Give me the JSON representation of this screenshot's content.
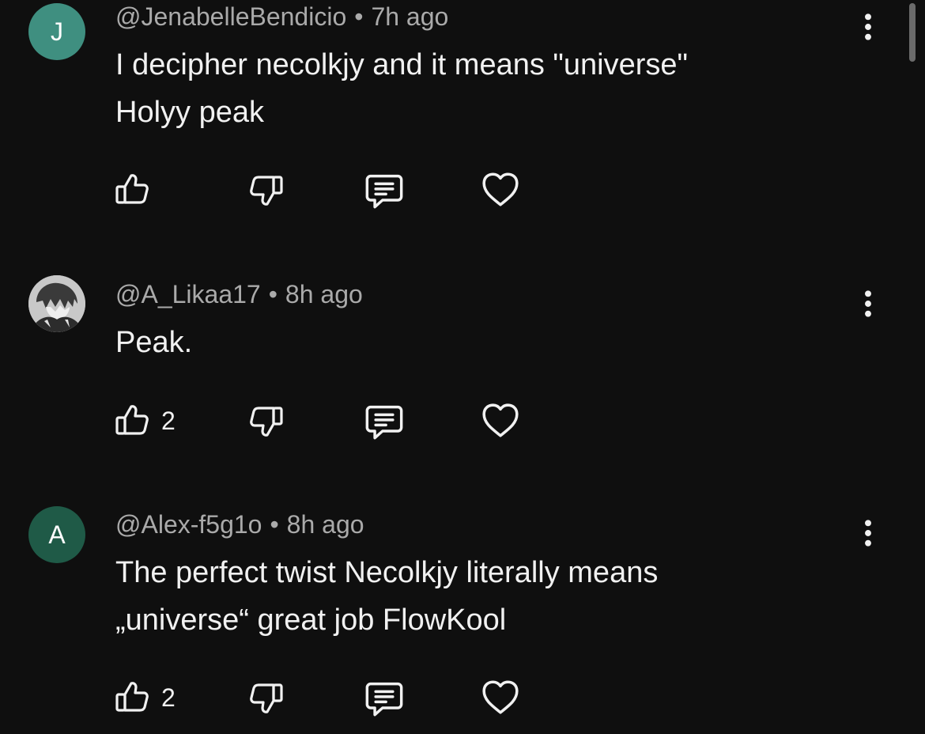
{
  "colors": {
    "background": "#0f0f0f",
    "text_primary": "#f1f1f1",
    "text_secondary": "#aaaaaa",
    "avatar_j": "#3f8f80",
    "avatar_a": "#1f5a47"
  },
  "comments": [
    {
      "avatar_letter": "J",
      "author": "@JenabelleBendicio",
      "separator": "•",
      "time": "7h ago",
      "text": "I decipher necolkjy and it means \"universe\"\nHolyy peak",
      "like_count": "",
      "icons": [
        "thumbs-up-icon",
        "thumbs-down-icon",
        "reply-icon",
        "heart-icon",
        "more-vertical-icon"
      ]
    },
    {
      "avatar_letter": "",
      "author": "@A_Likaa17",
      "separator": "•",
      "time": "8h ago",
      "text": "Peak.",
      "like_count": "2",
      "icons": [
        "thumbs-up-icon",
        "thumbs-down-icon",
        "reply-icon",
        "heart-icon",
        "more-vertical-icon"
      ]
    },
    {
      "avatar_letter": "A",
      "author": "@Alex-f5g1o",
      "separator": "•",
      "time": "8h ago",
      "text": "The perfect twist Necolkjy literally means\n„universe“ great job FlowKool",
      "like_count": "2",
      "icons": [
        "thumbs-up-icon",
        "thumbs-down-icon",
        "reply-icon",
        "heart-icon",
        "more-vertical-icon"
      ]
    }
  ]
}
